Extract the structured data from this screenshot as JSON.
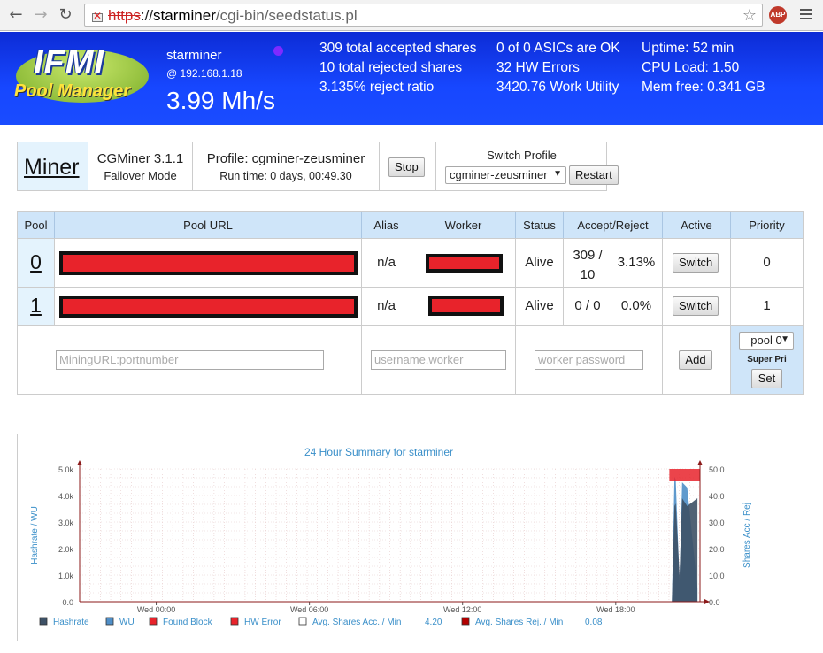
{
  "browser": {
    "url_scheme": "https",
    "url_host": "starminer",
    "url_path": "/cgi-bin/seedstatus.pl",
    "abp_label": "ABP"
  },
  "header": {
    "logo_line1": "IFMI",
    "logo_line2": "Pool Manager",
    "hostname": "starminer",
    "ip": "@ 192.168.1.18",
    "hashrate": "3.99 Mh/s",
    "stats": {
      "accepted": "309 total accepted shares",
      "rejected": "10 total rejected shares",
      "reject_ratio": "3.135% reject ratio",
      "asics": "0 of 0 ASICs are OK",
      "hw_errors": "32 HW Errors",
      "work_utility": "3420.76 Work Utility",
      "uptime": "Uptime: 52 min",
      "cpu": "CPU Load: 1.50",
      "mem": "Mem free: 0.341 GB"
    }
  },
  "miner": {
    "title": "Miner",
    "version": "CGMiner 3.1.1",
    "mode": "Failover Mode",
    "profile": "Profile: cgminer-zeusminer",
    "runtime": "Run time: 0 days, 00:49.30",
    "stop_label": "Stop",
    "switch_profile_label": "Switch Profile",
    "profile_selected": "cgminer-zeusminer",
    "restart_label": "Restart"
  },
  "pools": {
    "headers": [
      "Pool",
      "Pool URL",
      "Alias",
      "Worker",
      "Status",
      "Accept/Reject",
      "Active",
      "Priority"
    ],
    "rows": [
      {
        "id": "0",
        "alias": "n/a",
        "status": "Alive",
        "accept": "309 /",
        "reject": "10",
        "ratio": "3.13%",
        "switch": "Switch",
        "priority": "0"
      },
      {
        "id": "1",
        "alias": "n/a",
        "status": "Alive",
        "accept": "0 / 0",
        "reject": "",
        "ratio": "0.0%",
        "switch": "Switch",
        "priority": "1"
      }
    ],
    "add": {
      "url_placeholder": "MiningURL:portnumber",
      "worker_placeholder": "username.worker",
      "password_placeholder": "worker password",
      "add_label": "Add",
      "pool_select": "pool 0",
      "super_pri": "Super Pri",
      "set_label": "Set"
    }
  },
  "chart_data": {
    "type": "area",
    "title": "24 Hour Summary for starminer",
    "ylabel": "Hashrate / WU",
    "y2label": "Shares Acc / Rej",
    "ylim": [
      0,
      5000
    ],
    "y2lim": [
      0,
      50
    ],
    "yticks": [
      "0.0",
      "1.0k",
      "2.0k",
      "3.0k",
      "4.0k",
      "5.0k"
    ],
    "y2ticks": [
      "0.0",
      "10.0",
      "20.0",
      "30.0",
      "40.0",
      "50.0"
    ],
    "xticks": [
      "Wed 00:00",
      "Wed 06:00",
      "Wed 12:00",
      "Wed 18:00"
    ],
    "xtick_hours": [
      0,
      6,
      12,
      18
    ],
    "xlim_hours": [
      -3,
      21.3
    ],
    "series": [
      {
        "name": "Hashrate",
        "color": "#3d5166",
        "x_hours": [
          20.2,
          20.3,
          20.35,
          20.5,
          20.6,
          20.8,
          21.2
        ],
        "values": [
          0,
          3600,
          3700,
          1000,
          3900,
          3600,
          3900
        ]
      },
      {
        "name": "WU",
        "color": "#4f8fc8",
        "x_hours": [
          20.2,
          20.3,
          20.35,
          20.5,
          20.6,
          20.8,
          21.2
        ],
        "values": [
          0,
          4700,
          4600,
          700,
          4500,
          4300,
          500
        ]
      },
      {
        "name": "Found Block",
        "color": "#e8232b",
        "values": []
      },
      {
        "name": "HW Error",
        "color": "#e8232b",
        "x_hours": [
          20.1,
          21.3
        ],
        "values": [
          50,
          50
        ]
      },
      {
        "name": "Avg. Shares Acc. / Min",
        "color": "#ffffff",
        "legend_value": "4.20"
      },
      {
        "name": "Avg. Shares Rej. / Min",
        "color": "#b30000",
        "legend_value": "0.08"
      }
    ],
    "grid": true,
    "legend_position": "bottom"
  }
}
